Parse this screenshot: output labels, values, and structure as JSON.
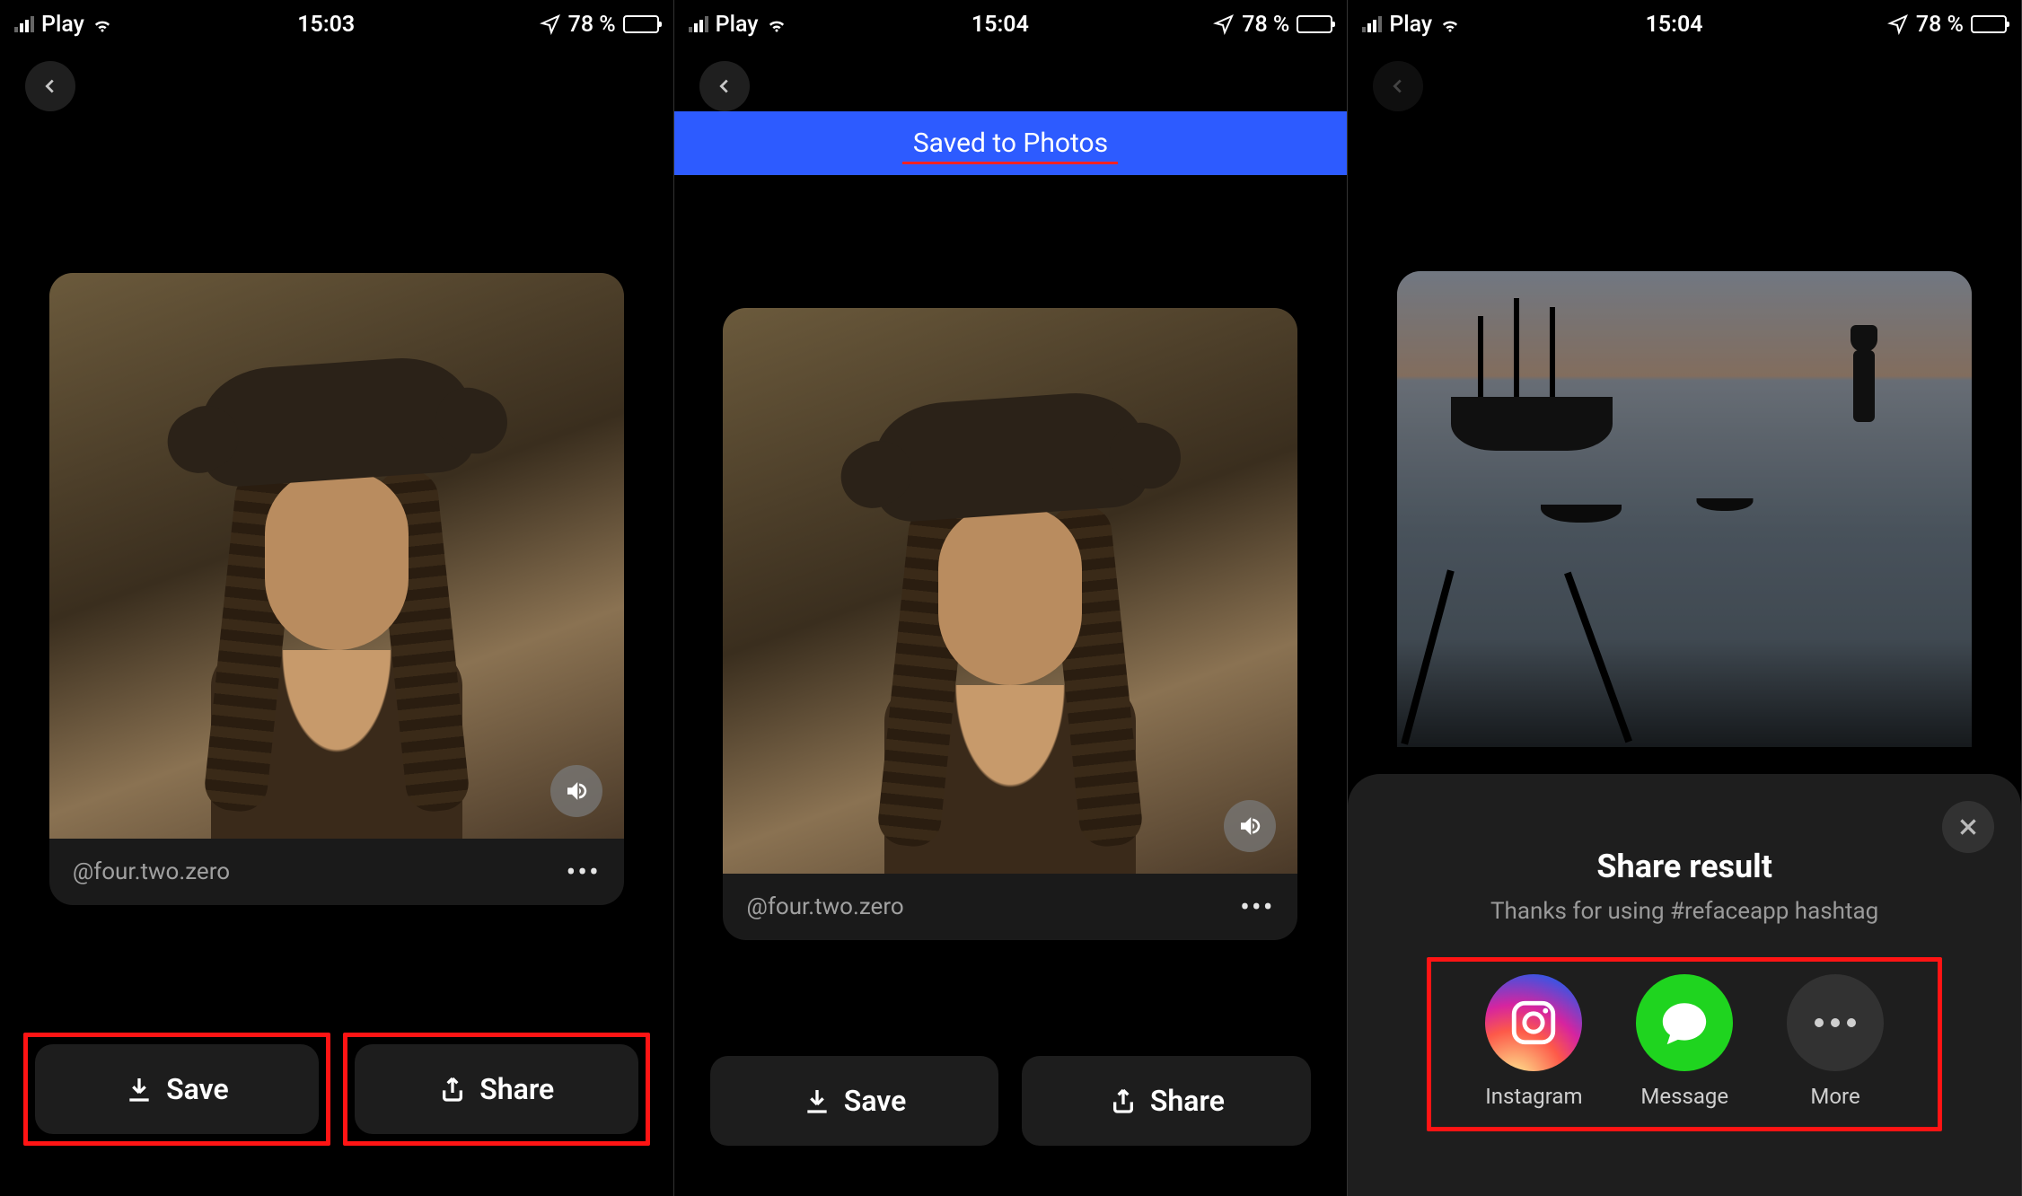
{
  "status": {
    "carrier": "Play",
    "battery_pct": "78 %"
  },
  "screens": [
    {
      "time": "15:03"
    },
    {
      "time": "15:04",
      "banner": "Saved to Photos"
    },
    {
      "time": "15:04"
    }
  ],
  "media": {
    "caption": "@four.two.zero"
  },
  "actions": {
    "save": "Save",
    "share": "Share"
  },
  "sheet": {
    "title": "Share result",
    "subtitle": "Thanks for using #refaceapp hashtag",
    "items": {
      "instagram": "Instagram",
      "message": "Message",
      "more": "More"
    }
  }
}
